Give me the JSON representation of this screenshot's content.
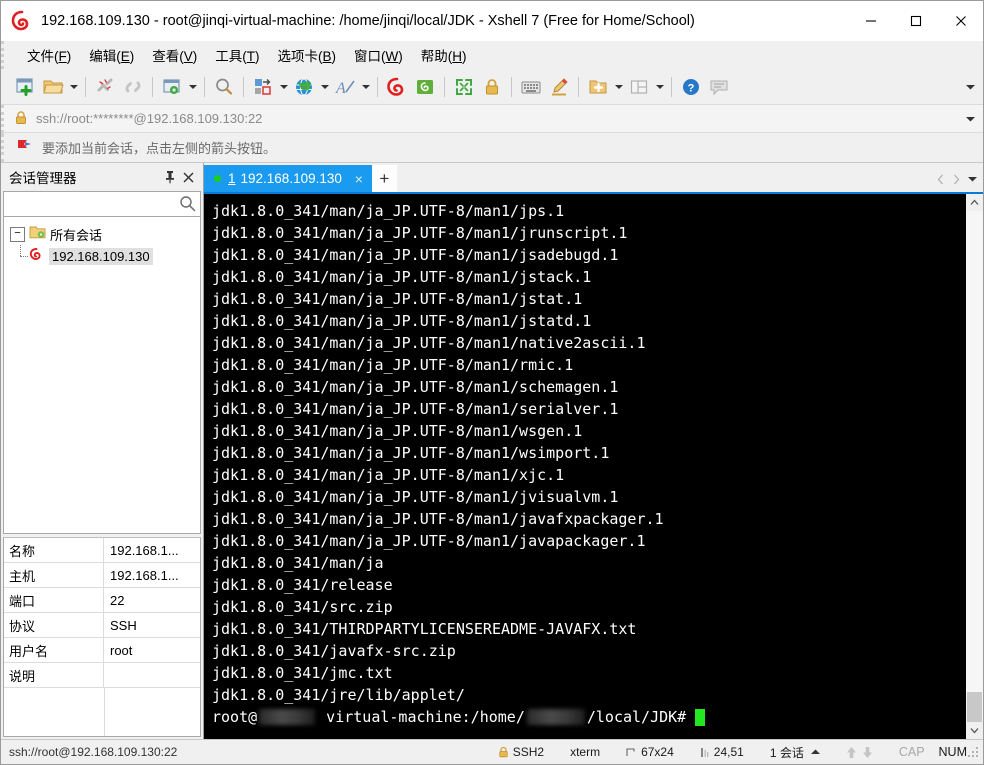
{
  "window": {
    "title": "192.168.109.130 - root@jinqi-virtual-machine: /home/jinqi/local/JDK - Xshell 7 (Free for Home/School)",
    "logo_icon": "xshell-logo-icon",
    "minimize_label": "─",
    "maximize_icon": "maximize-icon",
    "close_icon": "close-icon"
  },
  "menubar": {
    "items": [
      {
        "label": "文件",
        "mnemonic": "F"
      },
      {
        "label": "编辑",
        "mnemonic": "E"
      },
      {
        "label": "查看",
        "mnemonic": "V"
      },
      {
        "label": "工具",
        "mnemonic": "T"
      },
      {
        "label": "选项卡",
        "mnemonic": "B"
      },
      {
        "label": "窗口",
        "mnemonic": "W"
      },
      {
        "label": "帮助",
        "mnemonic": "H"
      }
    ]
  },
  "toolbar": {
    "overflow_icon": "chevron-down-icon",
    "buttons": [
      {
        "name": "new-session-button",
        "icon": "new-window-plus-icon"
      },
      {
        "name": "open-session-button",
        "icon": "folder-open-icon"
      },
      {
        "name": "open-session-dropdown",
        "icon": "chevron-down-icon"
      },
      {
        "name": "disconnect-button",
        "icon": "broken-link-icon"
      },
      {
        "name": "reconnect-button",
        "icon": "link-icon"
      },
      {
        "name": "session-properties-button",
        "icon": "window-gear-icon"
      },
      {
        "name": "session-properties-dropdown",
        "icon": "chevron-down-icon"
      },
      {
        "name": "find-button",
        "icon": "magnifier-icon"
      },
      {
        "name": "transfer-button",
        "icon": "file-transfer-icon"
      },
      {
        "name": "transfer-dropdown",
        "icon": "chevron-down-icon"
      },
      {
        "name": "encoding-button",
        "icon": "globe-icon"
      },
      {
        "name": "encoding-dropdown",
        "icon": "chevron-down-icon"
      },
      {
        "name": "font-button",
        "icon": "font-a-icon"
      },
      {
        "name": "font-dropdown",
        "icon": "chevron-down-icon"
      },
      {
        "name": "xshell-button",
        "icon": "xshell-red-icon"
      },
      {
        "name": "xftp-button",
        "icon": "xftp-green-icon"
      },
      {
        "name": "fullscreen-button",
        "icon": "fullscreen-arrows-icon"
      },
      {
        "name": "lock-button",
        "icon": "lock-icon"
      },
      {
        "name": "keyboard-button",
        "icon": "keyboard-icon"
      },
      {
        "name": "highlight-button",
        "icon": "highlighter-pen-icon"
      },
      {
        "name": "add-to-sessions-button",
        "icon": "folder-plus-icon"
      },
      {
        "name": "add-to-sessions-dropdown",
        "icon": "chevron-down-icon"
      },
      {
        "name": "layout-button",
        "icon": "layout-panes-icon"
      },
      {
        "name": "layout-dropdown",
        "icon": "chevron-down-icon"
      },
      {
        "name": "help-button",
        "icon": "help-question-icon"
      },
      {
        "name": "comment-button",
        "icon": "speech-bubble-icon"
      }
    ]
  },
  "address_bar": {
    "lock_icon": "lock-icon",
    "value": "ssh://root:********@192.168.109.130:22",
    "dropdown_icon": "chevron-down-icon"
  },
  "notice_bar": {
    "icon": "red-arrow-flag-icon",
    "text": "要添加当前会话，点击左侧的箭头按钮。"
  },
  "session_manager": {
    "title": "会话管理器",
    "pin_icon": "pin-icon",
    "close_icon": "close-icon",
    "search": {
      "value": "",
      "placeholder": "",
      "icon": "search-icon"
    },
    "tree": {
      "root": {
        "label": "所有会话",
        "icon": "folder-sessions-icon",
        "expander": "−"
      },
      "children": [
        {
          "label": "192.168.109.130",
          "icon": "xshell-session-icon",
          "selected": true
        }
      ]
    },
    "properties": [
      {
        "key": "名称",
        "value": "192.168.1..."
      },
      {
        "key": "主机",
        "value": "192.168.1..."
      },
      {
        "key": "端口",
        "value": "22"
      },
      {
        "key": "协议",
        "value": "SSH"
      },
      {
        "key": "用户名",
        "value": "root"
      },
      {
        "key": "说明",
        "value": ""
      }
    ]
  },
  "tabs": {
    "items": [
      {
        "number": "1",
        "label": "192.168.109.130",
        "active": true,
        "status_dot": "#18d018",
        "close_icon": "close-icon"
      }
    ],
    "new_tab_icon": "plus-icon",
    "nav_prev_icon": "chevron-left-icon",
    "nav_next_icon": "chevron-right-icon",
    "nav_list_icon": "chevron-down-icon"
  },
  "terminal": {
    "background": "#000000",
    "foreground": "#ffffff",
    "cursor_color": "#22e822",
    "lines": [
      "jdk1.8.0_341/man/ja_JP.UTF-8/man1/jps.1",
      "jdk1.8.0_341/man/ja_JP.UTF-8/man1/jrunscript.1",
      "jdk1.8.0_341/man/ja_JP.UTF-8/man1/jsadebugd.1",
      "jdk1.8.0_341/man/ja_JP.UTF-8/man1/jstack.1",
      "jdk1.8.0_341/man/ja_JP.UTF-8/man1/jstat.1",
      "jdk1.8.0_341/man/ja_JP.UTF-8/man1/jstatd.1",
      "jdk1.8.0_341/man/ja_JP.UTF-8/man1/native2ascii.1",
      "jdk1.8.0_341/man/ja_JP.UTF-8/man1/rmic.1",
      "jdk1.8.0_341/man/ja_JP.UTF-8/man1/schemagen.1",
      "jdk1.8.0_341/man/ja_JP.UTF-8/man1/serialver.1",
      "jdk1.8.0_341/man/ja_JP.UTF-8/man1/wsgen.1",
      "jdk1.8.0_341/man/ja_JP.UTF-8/man1/wsimport.1",
      "jdk1.8.0_341/man/ja_JP.UTF-8/man1/xjc.1",
      "jdk1.8.0_341/man/ja_JP.UTF-8/man1/jvisualvm.1",
      "jdk1.8.0_341/man/ja_JP.UTF-8/man1/javafxpackager.1",
      "jdk1.8.0_341/man/ja_JP.UTF-8/man1/javapackager.1",
      "jdk1.8.0_341/man/ja",
      "jdk1.8.0_341/release",
      "jdk1.8.0_341/src.zip",
      "jdk1.8.0_341/THIRDPARTYLICENSEREADME-JAVAFX.txt",
      "jdk1.8.0_341/javafx-src.zip",
      "jdk1.8.0_341/jmc.txt",
      "jdk1.8.0_341/jre/lib/applet/"
    ],
    "prompt": {
      "prefix": "root@",
      "redacted_host": true,
      "middle": " virtual-machine:/home/",
      "redacted_user": true,
      "suffix": "/local/JDK#"
    },
    "scrollbar": {
      "up_icon": "chevron-up-icon",
      "down_icon": "chevron-down-icon"
    }
  },
  "status_bar": {
    "connection": "ssh://root@192.168.109.130:22",
    "protocol": "SSH2",
    "protocol_icon": "lock-icon",
    "terminal_type": "xterm",
    "size": "67x24",
    "size_icon": "resize-icon",
    "cursor_position": "24,51",
    "cursor_icon": "cursor-pos-icon",
    "sessions": "1 会话",
    "sessions_arrow_icon": "triangle-up-icon",
    "transfer_up_icon": "arrow-up-icon",
    "transfer_down_icon": "arrow-down-icon",
    "cap": "CAP",
    "num": "NUM"
  }
}
